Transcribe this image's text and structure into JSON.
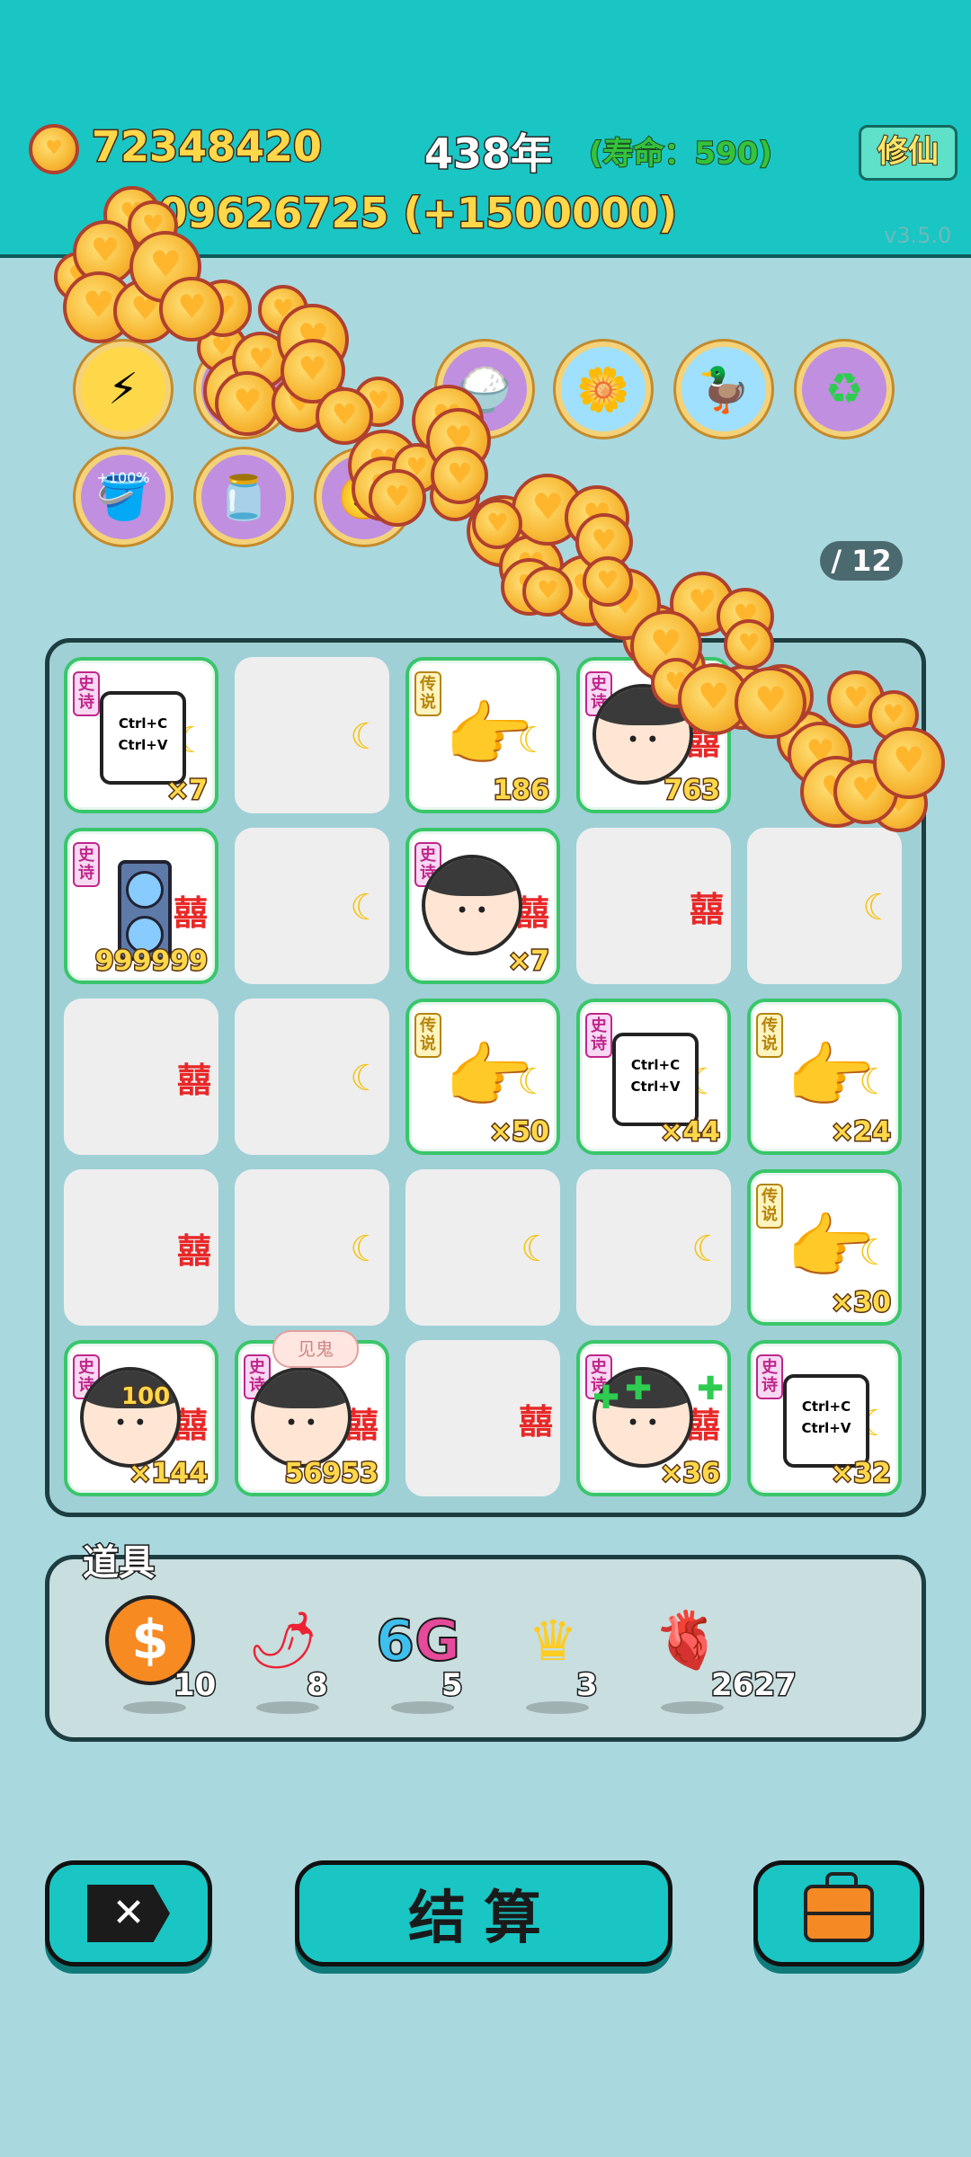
{
  "header": {
    "coins": "72348420",
    "year": "438年",
    "lifespan": "(寿命：590)",
    "cultivate_button": "修仙",
    "income": ":109626725 (+1500000)",
    "version": "v3.5.0"
  },
  "skills_page": "/ 12",
  "skill_row2_bonus": "+100%",
  "board": {
    "rows": [
      [
        {
          "tag": "史诗",
          "item": "copy-paste",
          "count": "×7"
        },
        {
          "item": "empty-moon"
        },
        {
          "tag": "传说",
          "item": "pointing-hand",
          "count": "186"
        },
        {
          "tag": "史诗",
          "item": "face",
          "count": "763"
        },
        {
          "item": "hidden"
        }
      ],
      [
        {
          "tag": "史诗",
          "item": "gpu",
          "count": "999999"
        },
        {
          "item": "empty-moon"
        },
        {
          "tag": "史诗",
          "item": "face",
          "count": "×7"
        },
        {
          "item": "empty-xi"
        },
        {
          "item": "empty-moon"
        }
      ],
      [
        {
          "item": "empty-xi"
        },
        {
          "item": "empty-moon"
        },
        {
          "tag": "传说",
          "item": "pointing-hand",
          "count": "×50"
        },
        {
          "tag": "史诗",
          "item": "copy-paste",
          "count": "×44"
        },
        {
          "tag": "传说",
          "item": "pointing-hand",
          "count": "×24"
        }
      ],
      [
        {
          "item": "empty-xi"
        },
        {
          "item": "empty-moon"
        },
        {
          "item": "empty-moon"
        },
        {
          "item": "empty-moon"
        },
        {
          "tag": "传说",
          "item": "pointing-hand",
          "count": "×30"
        }
      ],
      [
        {
          "tag": "史诗",
          "item": "face",
          "count": "×144",
          "bonus": "100"
        },
        {
          "tag": "史诗",
          "item": "face",
          "count": "56953"
        },
        {
          "item": "empty-xi"
        },
        {
          "tag": "史诗",
          "item": "face",
          "count": "×36"
        },
        {
          "tag": "史诗",
          "item": "copy-paste",
          "count": "×32"
        }
      ]
    ],
    "copy_text_1": "Ctrl+C",
    "copy_text_2": "Ctrl+V",
    "xi_char": "囍",
    "bubble": "见鬼"
  },
  "items": {
    "title": "道具",
    "list": [
      {
        "name": "coin-dollar",
        "count": "10"
      },
      {
        "name": "chili-pepper",
        "count": "8"
      },
      {
        "name": "6g",
        "count": "5"
      },
      {
        "name": "crown",
        "count": "3"
      },
      {
        "name": "liver",
        "count": "2627"
      }
    ],
    "six_label": "6",
    "g_label": "G"
  },
  "buttons": {
    "settle": "结算"
  },
  "colors": {
    "teal": "#19c6c4",
    "background": "#a9d9df",
    "gold": "#ffd84a"
  }
}
